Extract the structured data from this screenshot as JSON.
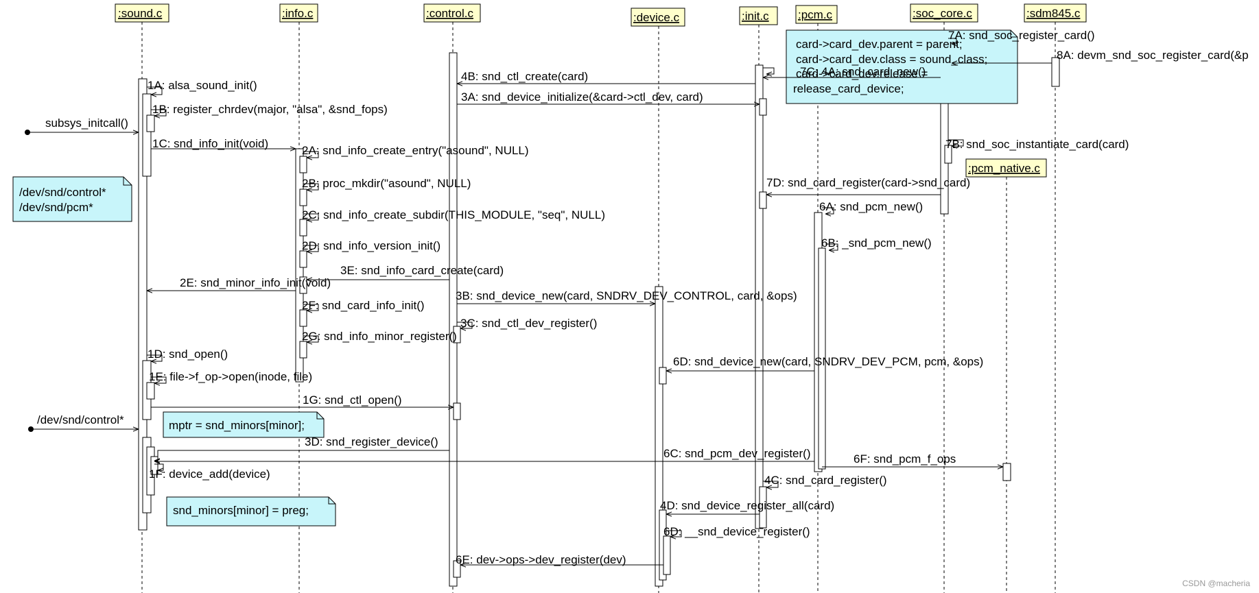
{
  "lifelines": {
    "sound": ":sound.c",
    "info": ":info.c",
    "control": ":control.c",
    "device": ":device.c",
    "init": ":init.c",
    "pcm": ":pcm.c",
    "soc_core": ":soc_core.c",
    "sdm845": ":sdm845.c",
    "pcm_native": ":pcm_native.c"
  },
  "entries": {
    "subsys": "subsys_initcall()",
    "dev_control": "/dev/snd/control*"
  },
  "messages": {
    "m1A": "1A: alsa_sound_init()",
    "m1B": "1B: register_chrdev(major, \"alsa\", &snd_fops)",
    "m1C": "1C: snd_info_init(void)",
    "m2A": "2A: snd_info_create_entry(\"asound\", NULL)",
    "m2B": "2B: proc_mkdir(\"asound\", NULL)",
    "m2C": "2C: snd_info_create_subdir(THIS_MODULE, \"seq\", NULL)",
    "m2D": "2D: snd_info_version_init()",
    "m3E": "3E: snd_info_card_create(card)",
    "m2E": "2E: snd_minor_info_init(void)",
    "m2F": "2F: snd_card_info_init()",
    "m2G": "2G: snd_info_minor_register()",
    "m1D": "1D: snd_open()",
    "m1E": "1E: file->f_op->open(inode, file)",
    "m1G": "1G: snd_ctl_open()",
    "m3D": "3D: snd_register_device()",
    "m1F": "1F: device_add(device)",
    "m4B": "4B: snd_ctl_create(card)",
    "m3A": "3A: snd_device_initialize(&card->ctl_dev, card)",
    "m3B": "3B: snd_device_new(card, SNDRV_DEV_CONTROL, card, &ops)",
    "m3C": "3C: snd_ctl_dev_register()",
    "m6D1": "6D: snd_device_new(card, SNDRV_DEV_PCM, pcm, &ops)",
    "m6C": "6C: snd_pcm_dev_register()",
    "m6F": "6F: snd_pcm_f_ops",
    "m4C": "4C: snd_card_register()",
    "m4D": "4D: snd_device_register_all(card)",
    "m6D2": "6D: __snd_device_register()",
    "m6E": "6E: dev->ops->dev_register(dev)",
    "m7A": "7A: snd_soc_register_card()",
    "m8A": "8A: devm_snd_soc_register_card(&p",
    "m7C": "7C: 4A: snd_card_new()",
    "m7B": "7B: snd_soc_instantiate_card(card)",
    "m7D": "7D: snd_card_register(card->snd_card)",
    "m6A": "6A: snd_pcm_new()",
    "m6B": "6B: _snd_pcm_new()"
  },
  "notes": {
    "devnodes": [
      "/dev/snd/control*",
      "/dev/snd/pcm*"
    ],
    "mptr": "mptr = snd_minors[minor];",
    "sndminors": "snd_minors[minor] = preg;",
    "card": [
      "card->card_dev.parent = parent;",
      "card->card_dev.class = sound_class;",
      "card->card_dev.release =",
      "release_card_device;"
    ]
  },
  "watermark": "CSDN @macheria"
}
